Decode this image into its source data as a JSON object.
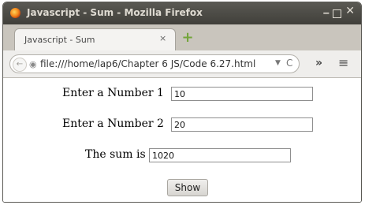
{
  "window": {
    "title": "Javascript - Sum - Mozilla Firefox",
    "min_glyph": "‒",
    "close_glyph": "✕"
  },
  "tab": {
    "label": "Javascript - Sum",
    "close_glyph": "×",
    "new_tab_glyph": "+"
  },
  "navbar": {
    "back_glyph": "←",
    "url": "file:///home/lap6/Chapter 6 JS/Code 6.27.html",
    "dropdown_glyph": "▼",
    "reload_glyph": "C",
    "overflow_glyph": "»",
    "menu_glyph": "≡"
  },
  "form": {
    "label1": "Enter a Number 1",
    "value1": "10",
    "label2": "Enter a Number 2",
    "value2": "20",
    "sum_label": "The sum is",
    "sum_value": "1020",
    "button_label": "Show"
  },
  "icons": {
    "logo": "firefox-logo-icon",
    "new_tab": "new-tab-icon",
    "back": "back-arrow-icon",
    "site": "globe-icon",
    "overflow": "chevron-double-right-icon",
    "menu": "hamburger-menu-icon"
  }
}
